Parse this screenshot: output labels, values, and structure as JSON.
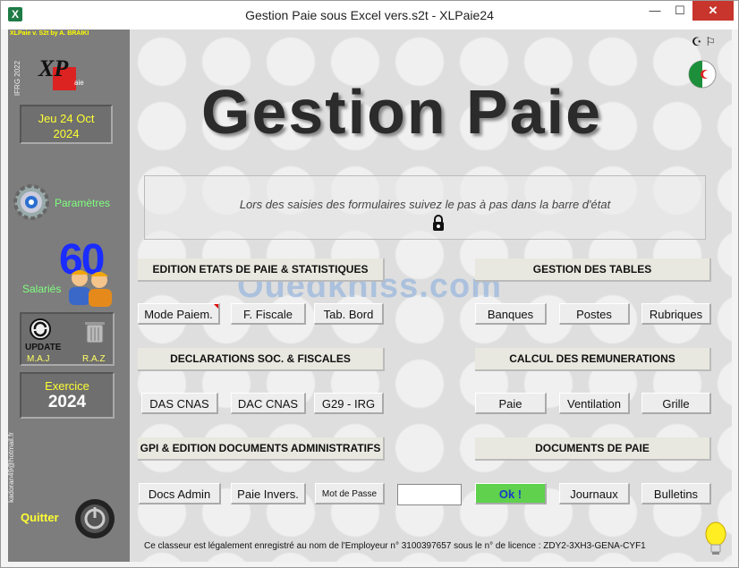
{
  "window": {
    "title": "Gestion Paie sous Excel vers.s2t - XLPaie24",
    "app_icon": "X",
    "minimize": "—",
    "maximize": "☐",
    "close": "✕"
  },
  "sidebar": {
    "credits": "XLPaie v. S2t    by A. BRAIKI",
    "ifrg": "IFRG 2022",
    "logo_text": "XL Paie",
    "date_line1": "Jeu 24 Oct",
    "date_line2": "2024",
    "params_label": "Paramètres",
    "salaries_count": "60",
    "salaries_label": "Salariés",
    "update_text": "UPDATE",
    "maj_label": "M.A.J",
    "raz_label": "R.A.Z",
    "exercice_label": "Exercice",
    "exercice_year": "2024",
    "email": "kadoran49@hotmail.fr",
    "quit_label": "Quitter"
  },
  "main": {
    "corner_icons": "☪ ⚐",
    "heading": "Gestion Paie",
    "status_text": "Lors des saisies des formulaires suivez le pas à pas dans la barre d'état",
    "watermark": "Ouedkniss.com",
    "sections": {
      "edition_etats": "EDITION ETATS DE PAIE & STATISTIQUES",
      "gestion_tables": "GESTION DES TABLES",
      "declarations": "DECLARATIONS SOC. & FISCALES",
      "calcul_remunerations": "CALCUL DES REMUNERATIONS",
      "gpi_documents": "GPI & EDITION DOCUMENTS ADMINISTRATIFS",
      "documents_paie": "DOCUMENTS DE PAIE"
    },
    "buttons": {
      "mode_paiem": "Mode Paiem.",
      "f_fiscale": "F. Fiscale",
      "tab_bord": "Tab. Bord",
      "banques": "Banques",
      "postes": "Postes",
      "rubriques": "Rubriques",
      "das_cnas": "DAS CNAS",
      "dac_cnas": "DAC CNAS",
      "g29_irg": "G29 - IRG",
      "paie": "Paie",
      "ventilation": "Ventilation",
      "grille": "Grille",
      "docs_admin": "Docs Admin",
      "paie_invers": "Paie Invers.",
      "mot_de_passe": "Mot de Passe",
      "ok": "Ok !",
      "journaux": "Journaux",
      "bulletins": "Bulletins"
    },
    "password_value": "",
    "footer": "Ce classeur est légalement enregistré au nom de l'Employeur n° 3100397657 sous le n° de licence : ZDY2-3XH3-GENA-CYF1"
  }
}
